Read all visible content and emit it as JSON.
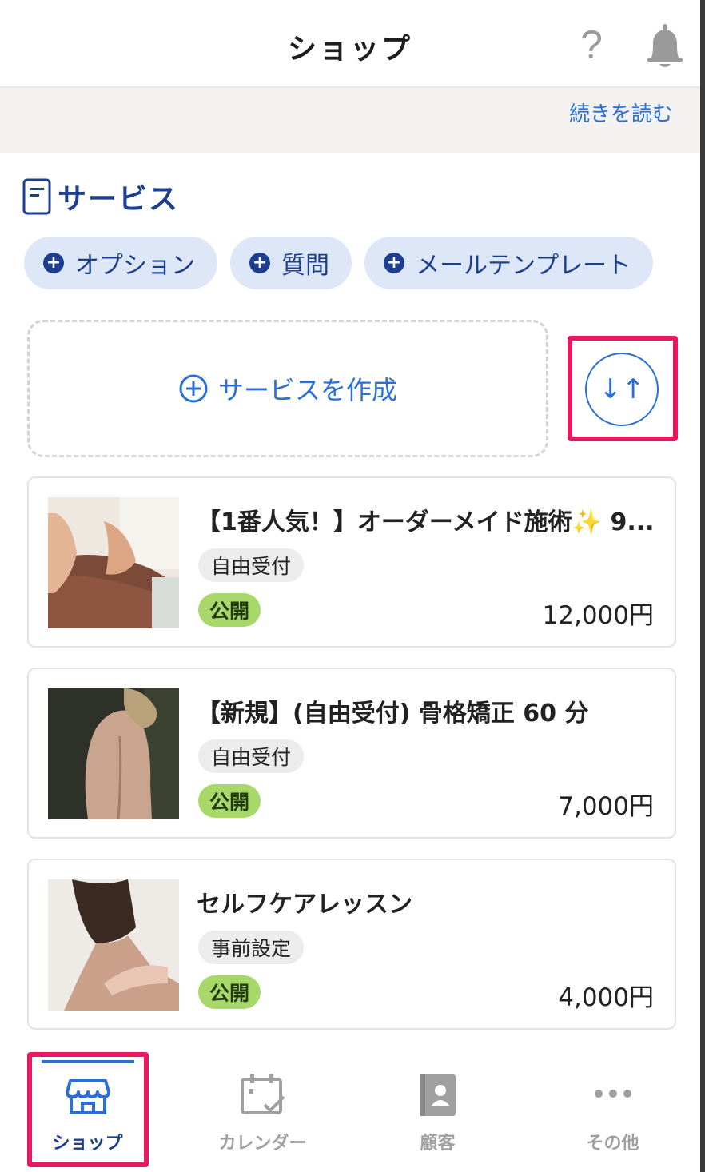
{
  "header": {
    "title": "ショップ",
    "help_icon": "?",
    "bell_icon_name": "bell-icon"
  },
  "notice": {
    "read_more_label": "続きを読む"
  },
  "section": {
    "title": "サービス",
    "icon_name": "document-icon"
  },
  "chips": [
    {
      "label": "オプション"
    },
    {
      "label": "質問"
    },
    {
      "label": "メールテンプレート"
    }
  ],
  "create_service": {
    "label": "サービスを作成"
  },
  "sort_button": {
    "glyph": "↓↑"
  },
  "services": [
    {
      "name": "【1番人気！】オーダーメイド施術✨ 9...",
      "reception_type": "自由受付",
      "status": "公開",
      "price": "12,000円"
    },
    {
      "name": "【新規】(自由受付) 骨格矯正 60 分",
      "reception_type": "自由受付",
      "status": "公開",
      "price": "7,000円"
    },
    {
      "name": "セルフケアレッスン",
      "reception_type": "事前設定",
      "status": "公開",
      "price": "4,000円"
    }
  ],
  "bottom_nav": [
    {
      "label": "ショップ",
      "active": true
    },
    {
      "label": "カレンダー",
      "active": false
    },
    {
      "label": "顧客",
      "active": false
    },
    {
      "label": "その他",
      "active": false
    }
  ],
  "colors": {
    "accent": "#2a6fd6",
    "brand_navy": "#1d3f8f",
    "chip_bg": "#dde7f8",
    "status_green": "#a8d86a",
    "highlight": "#e8195e"
  }
}
